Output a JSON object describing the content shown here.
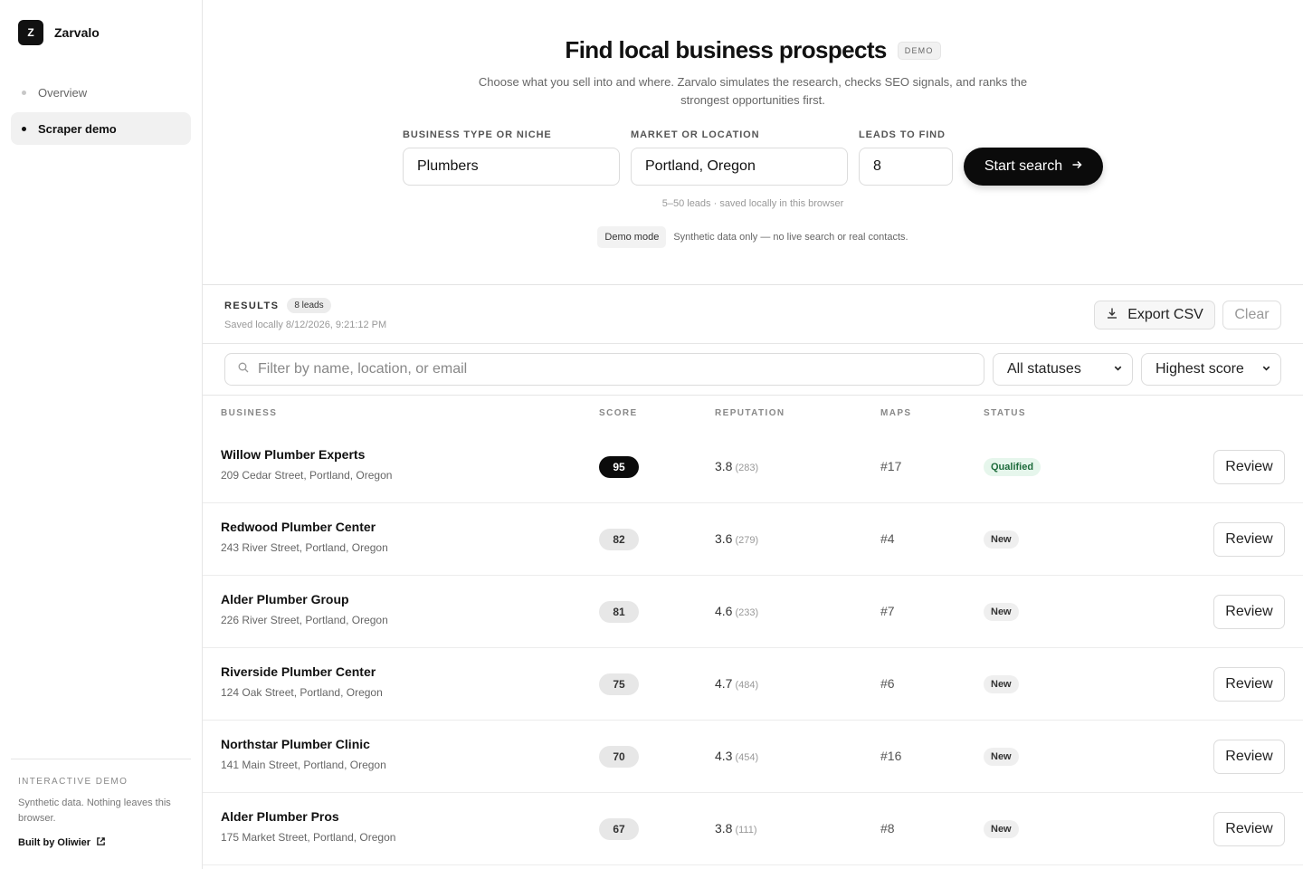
{
  "brand": {
    "logo_letter": "Z",
    "name": "Zarvalo"
  },
  "nav": [
    {
      "label": "Overview",
      "active": false
    },
    {
      "label": "Scraper demo",
      "active": true
    }
  ],
  "sidebar_footer": {
    "label": "INTERACTIVE DEMO",
    "text": "Synthetic data. Nothing leaves this browser.",
    "link": "Built by Oliwier"
  },
  "hero": {
    "title": "Find local business prospects",
    "badge": "DEMO",
    "subtitle": "Choose what you sell into and where. Zarvalo simulates the research, checks SEO signals, and ranks the strongest opportunities first."
  },
  "form": {
    "niche_label": "BUSINESS TYPE OR NICHE",
    "niche_value": "Plumbers",
    "location_label": "MARKET OR LOCATION",
    "location_value": "Portland, Oregon",
    "leads_label": "LEADS TO FIND",
    "leads_value": "8",
    "start_label": "Start search",
    "hint": "5–50 leads · saved locally in this browser",
    "mode_chip": "Demo mode",
    "mode_text": "Synthetic data only — no live search or real contacts."
  },
  "results": {
    "title": "RESULTS",
    "count": "8 leads",
    "saved": "Saved locally 8/12/2026, 9:21:12 PM",
    "export_label": "Export CSV",
    "clear_label": "Clear",
    "filter_placeholder": "Filter by name, location, or email",
    "status_filter": "All statuses",
    "sort": "Highest score"
  },
  "table": {
    "columns": [
      "BUSINESS",
      "SCORE",
      "REPUTATION",
      "MAPS",
      "STATUS"
    ],
    "review_label": "Review",
    "rows": [
      {
        "name": "Willow Plumber Experts",
        "address": "209 Cedar Street, Portland, Oregon",
        "score": "95",
        "rating": "3.8",
        "reviews": "(283)",
        "maps": "#17",
        "status": "Qualified"
      },
      {
        "name": "Redwood Plumber Center",
        "address": "243 River Street, Portland, Oregon",
        "score": "82",
        "rating": "3.6",
        "reviews": "(279)",
        "maps": "#4",
        "status": "New"
      },
      {
        "name": "Alder Plumber Group",
        "address": "226 River Street, Portland, Oregon",
        "score": "81",
        "rating": "4.6",
        "reviews": "(233)",
        "maps": "#7",
        "status": "New"
      },
      {
        "name": "Riverside Plumber Center",
        "address": "124 Oak Street, Portland, Oregon",
        "score": "75",
        "rating": "4.7",
        "reviews": "(484)",
        "maps": "#6",
        "status": "New"
      },
      {
        "name": "Northstar Plumber Clinic",
        "address": "141 Main Street, Portland, Oregon",
        "score": "70",
        "rating": "4.3",
        "reviews": "(454)",
        "maps": "#16",
        "status": "New"
      },
      {
        "name": "Alder Plumber Pros",
        "address": "175 Market Street, Portland, Oregon",
        "score": "67",
        "rating": "3.8",
        "reviews": "(111)",
        "maps": "#8",
        "status": "New"
      }
    ]
  },
  "colors": {
    "accent": "#0b0b0b",
    "qualified_bg": "#e6f6ec",
    "qualified_text": "#1d6b3b",
    "new_bg": "#efefef",
    "new_text": "#333333"
  }
}
